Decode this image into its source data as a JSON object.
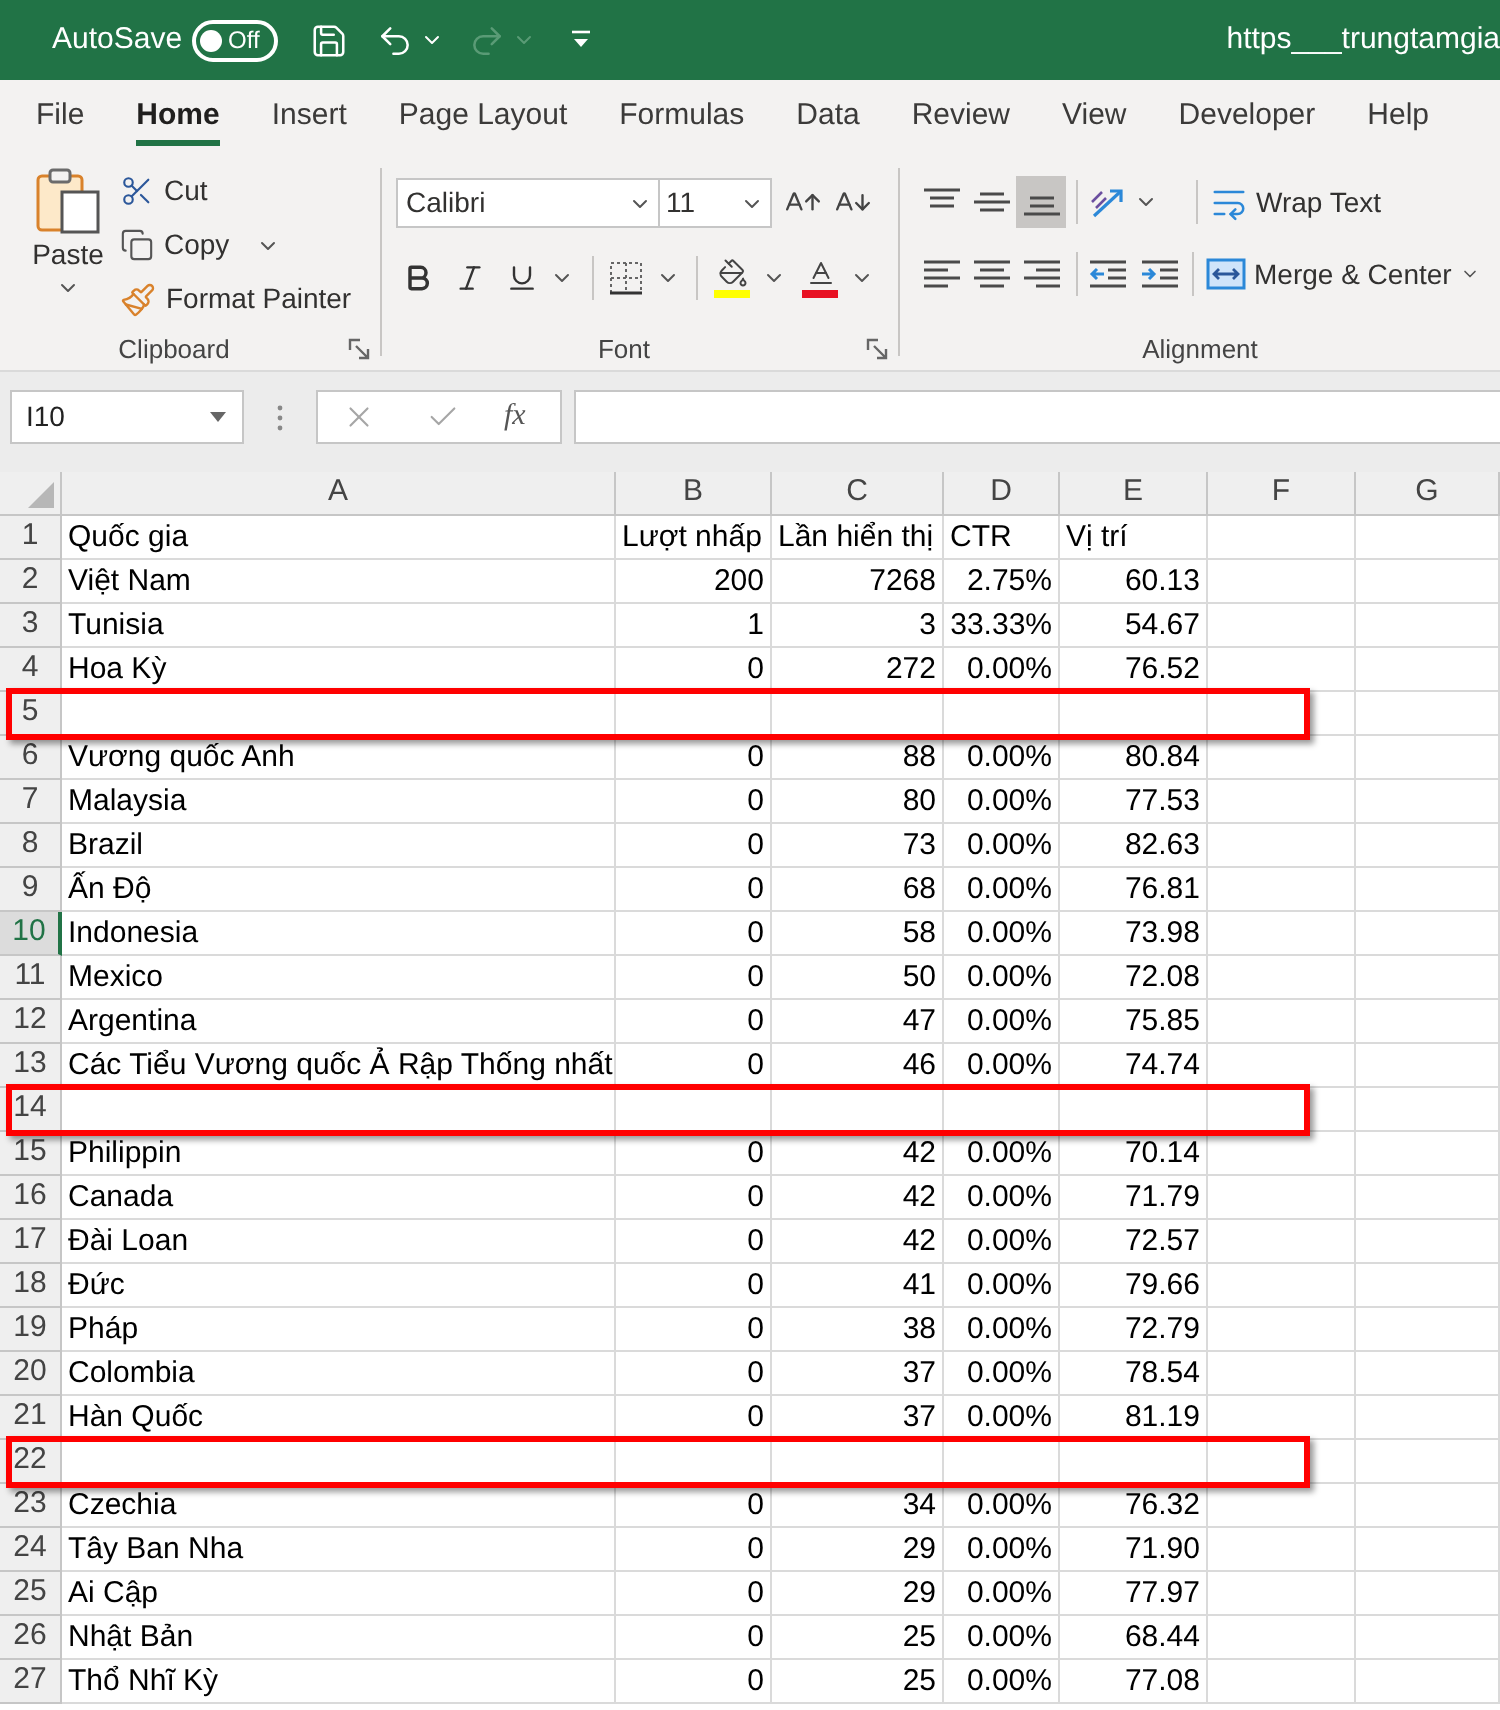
{
  "title_bar": {
    "autosave": {
      "label": "AutoSave",
      "on": false,
      "state_text": "Off"
    },
    "document_title": "https___trungtamgia"
  },
  "menu_tabs": [
    {
      "label": "File",
      "selected": false
    },
    {
      "label": "Home",
      "selected": true
    },
    {
      "label": "Insert",
      "selected": false
    },
    {
      "label": "Page Layout",
      "selected": false
    },
    {
      "label": "Formulas",
      "selected": false
    },
    {
      "label": "Data",
      "selected": false
    },
    {
      "label": "Review",
      "selected": false
    },
    {
      "label": "View",
      "selected": false
    },
    {
      "label": "Developer",
      "selected": false
    },
    {
      "label": "Help",
      "selected": false
    }
  ],
  "ribbon": {
    "clipboard": {
      "paste": "Paste",
      "cut": "Cut",
      "copy": "Copy",
      "format_painter": "Format Painter",
      "label": "Clipboard"
    },
    "font": {
      "font_name": "Calibri",
      "font_size": "11",
      "label": "Font"
    },
    "alignment": {
      "vertical_align": [
        {
          "kind": "top",
          "selected": false
        },
        {
          "kind": "middle",
          "selected": false
        },
        {
          "kind": "bottom",
          "selected": true
        }
      ],
      "horizontal_align": [
        {
          "kind": "left",
          "selected": false
        },
        {
          "kind": "center",
          "selected": false
        },
        {
          "kind": "right",
          "selected": false
        }
      ],
      "wrap_text": "Wrap Text",
      "merge_center": "Merge & Center",
      "label": "Alignment"
    }
  },
  "formula_bar": {
    "name_box": "I10",
    "function_button": "fx"
  },
  "sheet": {
    "columns": [
      "A",
      "B",
      "C",
      "D",
      "E",
      "F",
      "G"
    ],
    "rows": [
      {
        "number": "1",
        "kind": "heading",
        "cells": [
          "Quốc gia",
          "Lượt nhấp",
          "Lần hiển thị",
          "CTR",
          "Vị trí"
        ],
        "selected": false,
        "highlighted": false
      },
      {
        "number": "2",
        "kind": "data",
        "cells": [
          "Việt Nam",
          "200",
          "7268",
          "2.75%",
          "60.13"
        ],
        "selected": false,
        "highlighted": false
      },
      {
        "number": "3",
        "kind": "data",
        "cells": [
          "Tunisia",
          "1",
          "3",
          "33.33%",
          "54.67"
        ],
        "selected": false,
        "highlighted": false
      },
      {
        "number": "4",
        "kind": "data",
        "cells": [
          "Hoa Kỳ",
          "0",
          "272",
          "0.00%",
          "76.52"
        ],
        "selected": false,
        "highlighted": false
      },
      {
        "number": "5",
        "kind": "blank",
        "selected": false,
        "highlighted": true
      },
      {
        "number": "6",
        "kind": "data",
        "cells": [
          "Vương quốc Anh",
          "0",
          "88",
          "0.00%",
          "80.84"
        ],
        "selected": false,
        "highlighted": false
      },
      {
        "number": "7",
        "kind": "data",
        "cells": [
          "Malaysia",
          "0",
          "80",
          "0.00%",
          "77.53"
        ],
        "selected": false,
        "highlighted": false
      },
      {
        "number": "8",
        "kind": "data",
        "cells": [
          "Brazil",
          "0",
          "73",
          "0.00%",
          "82.63"
        ],
        "selected": false,
        "highlighted": false
      },
      {
        "number": "9",
        "kind": "data",
        "cells": [
          "Ấn Độ",
          "0",
          "68",
          "0.00%",
          "76.81"
        ],
        "selected": false,
        "highlighted": false
      },
      {
        "number": "10",
        "kind": "data",
        "cells": [
          "Indonesia",
          "0",
          "58",
          "0.00%",
          "73.98"
        ],
        "selected": true,
        "highlighted": false
      },
      {
        "number": "11",
        "kind": "data",
        "cells": [
          "Mexico",
          "0",
          "50",
          "0.00%",
          "72.08"
        ],
        "selected": false,
        "highlighted": false
      },
      {
        "number": "12",
        "kind": "data",
        "cells": [
          "Argentina",
          "0",
          "47",
          "0.00%",
          "75.85"
        ],
        "selected": false,
        "highlighted": false
      },
      {
        "number": "13",
        "kind": "data",
        "cells": [
          "Các Tiểu Vương quốc Ả Rập Thống nhất",
          "0",
          "46",
          "0.00%",
          "74.74"
        ],
        "selected": false,
        "highlighted": false
      },
      {
        "number": "14",
        "kind": "blank",
        "selected": false,
        "highlighted": true
      },
      {
        "number": "15",
        "kind": "data",
        "cells": [
          "Philippin",
          "0",
          "42",
          "0.00%",
          "70.14"
        ],
        "selected": false,
        "highlighted": false
      },
      {
        "number": "16",
        "kind": "data",
        "cells": [
          "Canada",
          "0",
          "42",
          "0.00%",
          "71.79"
        ],
        "selected": false,
        "highlighted": false
      },
      {
        "number": "17",
        "kind": "data",
        "cells": [
          "Đài Loan",
          "0",
          "42",
          "0.00%",
          "72.57"
        ],
        "selected": false,
        "highlighted": false
      },
      {
        "number": "18",
        "kind": "data",
        "cells": [
          "Đức",
          "0",
          "41",
          "0.00%",
          "79.66"
        ],
        "selected": false,
        "highlighted": false
      },
      {
        "number": "19",
        "kind": "data",
        "cells": [
          "Pháp",
          "0",
          "38",
          "0.00%",
          "72.79"
        ],
        "selected": false,
        "highlighted": false
      },
      {
        "number": "20",
        "kind": "data",
        "cells": [
          "Colombia",
          "0",
          "37",
          "0.00%",
          "78.54"
        ],
        "selected": false,
        "highlighted": false
      },
      {
        "number": "21",
        "kind": "data",
        "cells": [
          "Hàn Quốc",
          "0",
          "37",
          "0.00%",
          "81.19"
        ],
        "selected": false,
        "highlighted": false
      },
      {
        "number": "22",
        "kind": "blank",
        "selected": false,
        "highlighted": true
      },
      {
        "number": "23",
        "kind": "data",
        "cells": [
          "Czechia",
          "0",
          "34",
          "0.00%",
          "76.32"
        ],
        "selected": false,
        "highlighted": false
      },
      {
        "number": "24",
        "kind": "data",
        "cells": [
          "Tây Ban Nha",
          "0",
          "29",
          "0.00%",
          "71.90"
        ],
        "selected": false,
        "highlighted": false
      },
      {
        "number": "25",
        "kind": "data",
        "cells": [
          "Ai Cập",
          "0",
          "29",
          "0.00%",
          "77.97"
        ],
        "selected": false,
        "highlighted": false
      },
      {
        "number": "26",
        "kind": "data",
        "cells": [
          "Nhật Bản",
          "0",
          "25",
          "0.00%",
          "68.44"
        ],
        "selected": false,
        "highlighted": false
      },
      {
        "number": "27",
        "kind": "data",
        "cells": [
          "Thổ Nhĩ Kỳ",
          "0",
          "25",
          "0.00%",
          "77.08"
        ],
        "selected": false,
        "highlighted": false
      }
    ]
  }
}
